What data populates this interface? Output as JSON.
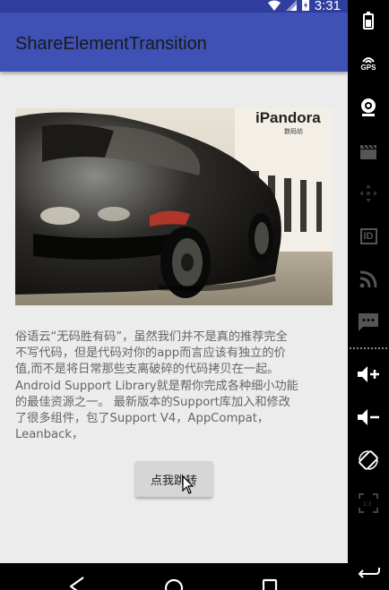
{
  "status_bar": {
    "time": "3:31"
  },
  "app_bar": {
    "title": "ShareElementTransition"
  },
  "hero_image": {
    "sign_text": "iPandora",
    "sign_subtext": "数码坊"
  },
  "content": {
    "paragraph": "俗语云“无码胜有码”，虽然我们并不是真的推荐完全\n不写代码，但是代码对你的app而言应该有独立的价\n值,而不是将日常那些支离破碎的代码拷贝在一起。\nAndroid Support Library就是帮你完成各种细小功能\n的最佳资源之一。 最新版本的Support库加入和修改\n了很多组件，包了Support V4，AppCompat，\nLeanback，",
    "button_label": "点我跳转"
  },
  "emulator_controls": {
    "gps_label": "GPS",
    "id_label": "ID",
    "icons": [
      "battery-icon",
      "gps-icon",
      "camera-icon",
      "clapperboard-icon",
      "dpad-icon",
      "id-icon",
      "rss-icon",
      "sms-icon",
      "volume-up-icon",
      "volume-down-icon",
      "rotate-icon",
      "scale-icon",
      "back-arrow-icon"
    ]
  },
  "colors": {
    "primary": "#3f51b5",
    "primary_dark": "#303f9f",
    "background": "#ececec",
    "text": "#666666"
  }
}
